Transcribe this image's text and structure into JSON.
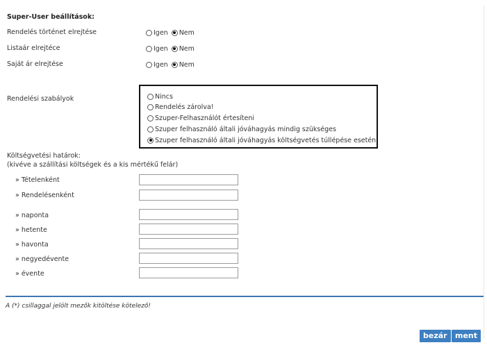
{
  "header": {
    "title": "Super-User beállítások:"
  },
  "settings": {
    "rows": [
      {
        "label": "Rendelés történet elrejtése",
        "opt_yes": "Igen",
        "opt_no": "Nem"
      },
      {
        "label": "Listaár elrejtéce",
        "opt_yes": "Igen",
        "opt_no": "Nem"
      },
      {
        "label": "Saját ár elrejtése",
        "opt_yes": "Igen",
        "opt_no": "Nem"
      }
    ]
  },
  "rules": {
    "label": "Rendelési szabályok",
    "options": [
      "Nincs",
      "Rendelés zárolva!",
      "Szuper-Felhasználót értesíteni",
      "Szuper felhasználó általi jóváhagyás mindig szükséges",
      "Szuper felhasználó általi jóváhagyás költségvetés túllépése esetén"
    ],
    "selected_index": 4
  },
  "budget": {
    "title": "Költségvetési határok:",
    "subtitle": "(kivéve a szállítási költségek és a kis mértékű felár)",
    "fields": [
      "» Tételenként",
      "» Rendelésenként",
      "» naponta",
      "» hetente",
      "» havonta",
      "» negyedévente",
      "» évente"
    ]
  },
  "footer": {
    "note": "A (*) csillaggal jelölt mezők kitöltése kötelező!",
    "close_label": "bezár",
    "save_label": "ment"
  }
}
